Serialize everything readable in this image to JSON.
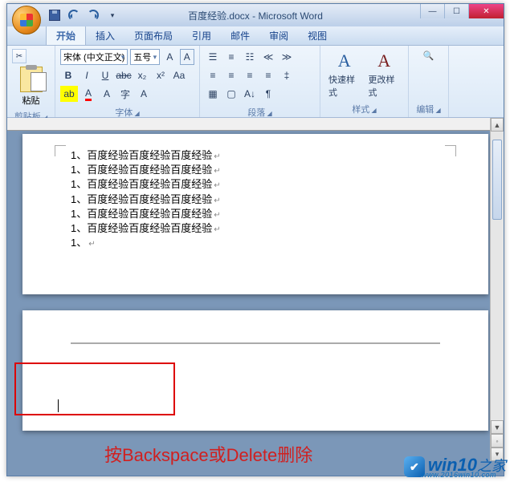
{
  "title": "百度经验.docx - Microsoft Word",
  "tabs": {
    "home": "开始",
    "insert": "插入",
    "layout": "页面布局",
    "ref": "引用",
    "mail": "邮件",
    "review": "审阅",
    "view": "视图"
  },
  "ribbon": {
    "clipboard": {
      "paste": "粘贴",
      "label": "剪贴板"
    },
    "font": {
      "name": "宋体 (中文正文)",
      "size": "五号",
      "label": "字体"
    },
    "paragraph": {
      "label": "段落"
    },
    "styles": {
      "quick": "快速样式",
      "change": "更改样式",
      "label": "样式"
    },
    "editing": {
      "label": "编辑"
    }
  },
  "document": {
    "lines": [
      "1、百度经验百度经验百度经验",
      "1、百度经验百度经验百度经验",
      "1、百度经验百度经验百度经验",
      "1、百度经验百度经验百度经验",
      "1、百度经验百度经验百度经验",
      "1、百度经验百度经验百度经验",
      "1、"
    ]
  },
  "annotation": {
    "instruction": "按Backspace或Delete删除"
  },
  "watermark": {
    "brand_main": "win10",
    "brand_sub": "之家",
    "url": "www.2016win10.com"
  },
  "winbtn": {
    "min": "—",
    "max": "☐",
    "close": "✕"
  }
}
